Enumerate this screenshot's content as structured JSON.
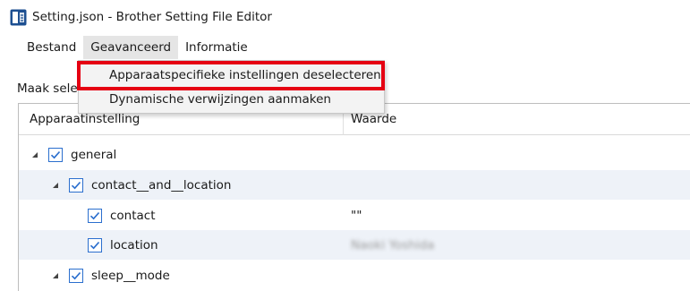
{
  "window": {
    "title": "Setting.json - Brother Setting File Editor",
    "app_icon": "brother-app-icon"
  },
  "menubar": {
    "items": [
      {
        "label": "Bestand"
      },
      {
        "label": "Geavanceerd"
      },
      {
        "label": "Informatie"
      }
    ]
  },
  "dropdown": {
    "items": [
      {
        "label": "Apparaatspecifieke instellingen deselecteren"
      },
      {
        "label": "Dynamische verwijzingen aanmaken"
      }
    ]
  },
  "prompt": {
    "text": "Maak sele"
  },
  "tree": {
    "columns": [
      {
        "label": "Apparaatinstelling"
      },
      {
        "label": "Waarde"
      }
    ],
    "rows": [
      {
        "label": "general",
        "value": "",
        "checked": true,
        "expanded": true
      },
      {
        "label": "contact__and__location",
        "value": "",
        "checked": true,
        "expanded": true
      },
      {
        "label": "contact",
        "value": "\"\"",
        "checked": true
      },
      {
        "label": "location",
        "value": "Naoki Yoshida",
        "checked": true
      },
      {
        "label": "sleep__mode",
        "value": "",
        "checked": true,
        "expanded": true
      }
    ]
  },
  "colors": {
    "accent": "#2b6fce",
    "highlight": "#e50012",
    "row_alt": "#eef2f8",
    "menu_active": "#e5e5e5"
  }
}
